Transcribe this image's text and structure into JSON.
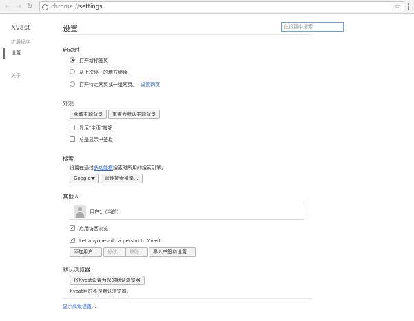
{
  "toolbar": {
    "back_icon": "arrow-left-icon",
    "forward_icon": "arrow-right-icon",
    "reload_icon": "reload-icon",
    "url_scheme": "chrome://",
    "url_path": "settings",
    "star_icon": "star-icon",
    "menu_icon": "vertical-dots-icon"
  },
  "sidebar": {
    "brand": "Xvast",
    "items": [
      {
        "label": "扩展程序"
      },
      {
        "label": "设置"
      },
      {
        "label": "关于"
      }
    ]
  },
  "main": {
    "title": "设置",
    "search_placeholder": "在设置中搜索",
    "startup": {
      "heading": "启动时",
      "options": [
        {
          "label": "打开新标签页",
          "selected": true
        },
        {
          "label": "从上次停下的地方继续",
          "selected": false
        },
        {
          "label": "打开特定网页或一组网页。",
          "selected": false,
          "link": "设置网页"
        }
      ]
    },
    "appearance": {
      "heading": "外观",
      "get_theme": "获取主题背景",
      "reset_theme": "重置为默认主题背景",
      "show_home": "显示\"主页\"按钮",
      "show_bookmarks": "总是显示书签栏"
    },
    "search": {
      "heading": "搜索",
      "desc_before": "设置在通过",
      "desc_link": "多功能框",
      "desc_after": "搜索时所用的搜索引擎。",
      "engine": "Google",
      "manage": "管理搜索引擎..."
    },
    "people": {
      "heading": "其他人",
      "person": "用户1（当前）",
      "guest": "启用访客浏览",
      "anyone": "Let anyone add a person to Xvast",
      "add": "添加用户...",
      "edit": "修改...",
      "remove": "移除...",
      "import": "导入书签和设置..."
    },
    "default_browser": {
      "heading": "默认浏览器",
      "button": "将Xvast设置为您的默认浏览器",
      "status": "Xvast目前不是默认浏览器。"
    },
    "advanced_link": "显示高级设置..."
  }
}
